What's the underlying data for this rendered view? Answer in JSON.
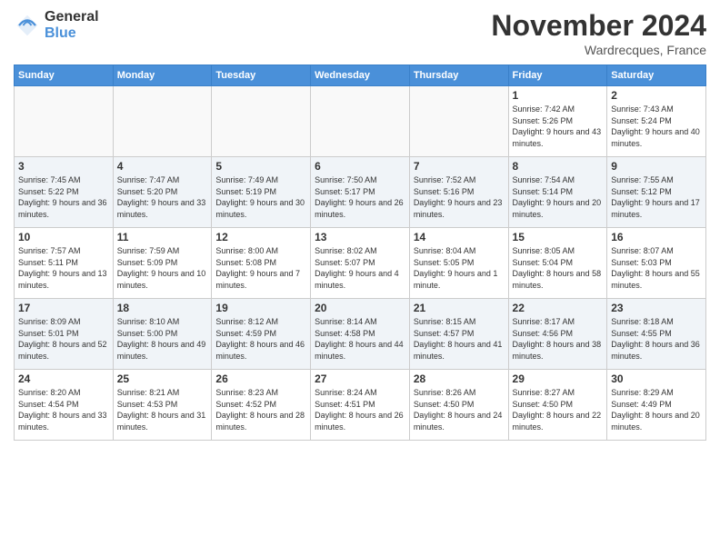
{
  "logo": {
    "general": "General",
    "blue": "Blue"
  },
  "title": "November 2024",
  "location": "Wardrecques, France",
  "days_header": [
    "Sunday",
    "Monday",
    "Tuesday",
    "Wednesday",
    "Thursday",
    "Friday",
    "Saturday"
  ],
  "weeks": [
    [
      {
        "num": "",
        "sunrise": "",
        "sunset": "",
        "daylight": "",
        "empty": true
      },
      {
        "num": "",
        "sunrise": "",
        "sunset": "",
        "daylight": "",
        "empty": true
      },
      {
        "num": "",
        "sunrise": "",
        "sunset": "",
        "daylight": "",
        "empty": true
      },
      {
        "num": "",
        "sunrise": "",
        "sunset": "",
        "daylight": "",
        "empty": true
      },
      {
        "num": "",
        "sunrise": "",
        "sunset": "",
        "daylight": "",
        "empty": true
      },
      {
        "num": "1",
        "sunrise": "Sunrise: 7:42 AM",
        "sunset": "Sunset: 5:26 PM",
        "daylight": "Daylight: 9 hours and 43 minutes.",
        "empty": false
      },
      {
        "num": "2",
        "sunrise": "Sunrise: 7:43 AM",
        "sunset": "Sunset: 5:24 PM",
        "daylight": "Daylight: 9 hours and 40 minutes.",
        "empty": false
      }
    ],
    [
      {
        "num": "3",
        "sunrise": "Sunrise: 7:45 AM",
        "sunset": "Sunset: 5:22 PM",
        "daylight": "Daylight: 9 hours and 36 minutes.",
        "empty": false
      },
      {
        "num": "4",
        "sunrise": "Sunrise: 7:47 AM",
        "sunset": "Sunset: 5:20 PM",
        "daylight": "Daylight: 9 hours and 33 minutes.",
        "empty": false
      },
      {
        "num": "5",
        "sunrise": "Sunrise: 7:49 AM",
        "sunset": "Sunset: 5:19 PM",
        "daylight": "Daylight: 9 hours and 30 minutes.",
        "empty": false
      },
      {
        "num": "6",
        "sunrise": "Sunrise: 7:50 AM",
        "sunset": "Sunset: 5:17 PM",
        "daylight": "Daylight: 9 hours and 26 minutes.",
        "empty": false
      },
      {
        "num": "7",
        "sunrise": "Sunrise: 7:52 AM",
        "sunset": "Sunset: 5:16 PM",
        "daylight": "Daylight: 9 hours and 23 minutes.",
        "empty": false
      },
      {
        "num": "8",
        "sunrise": "Sunrise: 7:54 AM",
        "sunset": "Sunset: 5:14 PM",
        "daylight": "Daylight: 9 hours and 20 minutes.",
        "empty": false
      },
      {
        "num": "9",
        "sunrise": "Sunrise: 7:55 AM",
        "sunset": "Sunset: 5:12 PM",
        "daylight": "Daylight: 9 hours and 17 minutes.",
        "empty": false
      }
    ],
    [
      {
        "num": "10",
        "sunrise": "Sunrise: 7:57 AM",
        "sunset": "Sunset: 5:11 PM",
        "daylight": "Daylight: 9 hours and 13 minutes.",
        "empty": false
      },
      {
        "num": "11",
        "sunrise": "Sunrise: 7:59 AM",
        "sunset": "Sunset: 5:09 PM",
        "daylight": "Daylight: 9 hours and 10 minutes.",
        "empty": false
      },
      {
        "num": "12",
        "sunrise": "Sunrise: 8:00 AM",
        "sunset": "Sunset: 5:08 PM",
        "daylight": "Daylight: 9 hours and 7 minutes.",
        "empty": false
      },
      {
        "num": "13",
        "sunrise": "Sunrise: 8:02 AM",
        "sunset": "Sunset: 5:07 PM",
        "daylight": "Daylight: 9 hours and 4 minutes.",
        "empty": false
      },
      {
        "num": "14",
        "sunrise": "Sunrise: 8:04 AM",
        "sunset": "Sunset: 5:05 PM",
        "daylight": "Daylight: 9 hours and 1 minute.",
        "empty": false
      },
      {
        "num": "15",
        "sunrise": "Sunrise: 8:05 AM",
        "sunset": "Sunset: 5:04 PM",
        "daylight": "Daylight: 8 hours and 58 minutes.",
        "empty": false
      },
      {
        "num": "16",
        "sunrise": "Sunrise: 8:07 AM",
        "sunset": "Sunset: 5:03 PM",
        "daylight": "Daylight: 8 hours and 55 minutes.",
        "empty": false
      }
    ],
    [
      {
        "num": "17",
        "sunrise": "Sunrise: 8:09 AM",
        "sunset": "Sunset: 5:01 PM",
        "daylight": "Daylight: 8 hours and 52 minutes.",
        "empty": false
      },
      {
        "num": "18",
        "sunrise": "Sunrise: 8:10 AM",
        "sunset": "Sunset: 5:00 PM",
        "daylight": "Daylight: 8 hours and 49 minutes.",
        "empty": false
      },
      {
        "num": "19",
        "sunrise": "Sunrise: 8:12 AM",
        "sunset": "Sunset: 4:59 PM",
        "daylight": "Daylight: 8 hours and 46 minutes.",
        "empty": false
      },
      {
        "num": "20",
        "sunrise": "Sunrise: 8:14 AM",
        "sunset": "Sunset: 4:58 PM",
        "daylight": "Daylight: 8 hours and 44 minutes.",
        "empty": false
      },
      {
        "num": "21",
        "sunrise": "Sunrise: 8:15 AM",
        "sunset": "Sunset: 4:57 PM",
        "daylight": "Daylight: 8 hours and 41 minutes.",
        "empty": false
      },
      {
        "num": "22",
        "sunrise": "Sunrise: 8:17 AM",
        "sunset": "Sunset: 4:56 PM",
        "daylight": "Daylight: 8 hours and 38 minutes.",
        "empty": false
      },
      {
        "num": "23",
        "sunrise": "Sunrise: 8:18 AM",
        "sunset": "Sunset: 4:55 PM",
        "daylight": "Daylight: 8 hours and 36 minutes.",
        "empty": false
      }
    ],
    [
      {
        "num": "24",
        "sunrise": "Sunrise: 8:20 AM",
        "sunset": "Sunset: 4:54 PM",
        "daylight": "Daylight: 8 hours and 33 minutes.",
        "empty": false
      },
      {
        "num": "25",
        "sunrise": "Sunrise: 8:21 AM",
        "sunset": "Sunset: 4:53 PM",
        "daylight": "Daylight: 8 hours and 31 minutes.",
        "empty": false
      },
      {
        "num": "26",
        "sunrise": "Sunrise: 8:23 AM",
        "sunset": "Sunset: 4:52 PM",
        "daylight": "Daylight: 8 hours and 28 minutes.",
        "empty": false
      },
      {
        "num": "27",
        "sunrise": "Sunrise: 8:24 AM",
        "sunset": "Sunset: 4:51 PM",
        "daylight": "Daylight: 8 hours and 26 minutes.",
        "empty": false
      },
      {
        "num": "28",
        "sunrise": "Sunrise: 8:26 AM",
        "sunset": "Sunset: 4:50 PM",
        "daylight": "Daylight: 8 hours and 24 minutes.",
        "empty": false
      },
      {
        "num": "29",
        "sunrise": "Sunrise: 8:27 AM",
        "sunset": "Sunset: 4:50 PM",
        "daylight": "Daylight: 8 hours and 22 minutes.",
        "empty": false
      },
      {
        "num": "30",
        "sunrise": "Sunrise: 8:29 AM",
        "sunset": "Sunset: 4:49 PM",
        "daylight": "Daylight: 8 hours and 20 minutes.",
        "empty": false
      }
    ]
  ]
}
